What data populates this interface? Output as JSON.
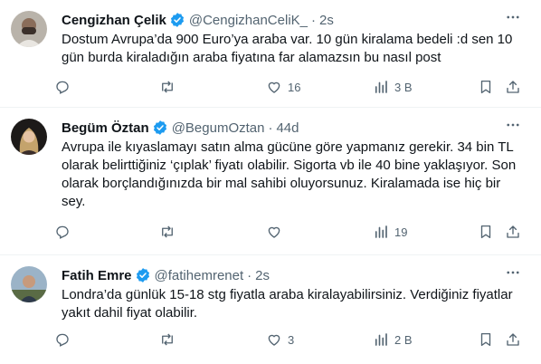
{
  "tweets": [
    {
      "name": "Cengizhan Çelik",
      "handle": "@CengizhanCeliK_",
      "separator": "·",
      "time": "2s",
      "text": "Dostum Avrupa’da 900 Euro’ya araba var. 10 gün kiralama bedeli :d sen 10 gün burda kiraladığın araba fiyatına far alamazsın bu nasıl post",
      "replies": "",
      "retweets": "",
      "likes": "16",
      "views": "3 B"
    },
    {
      "name": "Begüm Öztan",
      "handle": "@BegumOztan",
      "separator": "·",
      "time": "44d",
      "text": "Avrupa ile kıyaslamayı satın alma gücüne göre yapmanız gerekir. 34 bin TL olarak belirttiğiniz ‘çıplak’ fiyatı olabilir. Sigorta vb ile 40 bine yaklaşıyor. Son olarak borçlandığınızda bir mal sahibi oluyorsunuz. Kiralamada ise hiç bir sey.",
      "replies": "",
      "retweets": "",
      "likes": "",
      "views": "19"
    },
    {
      "name": "Fatih Emre",
      "handle": "@fatihemrenet",
      "separator": "·",
      "time": "2s",
      "text": "Londra’da günlük 15-18 stg fiyatla araba kiralayabilirsiniz. Verdiğiniz fiyatlar yakıt dahil fiyat olabilir.",
      "replies": "",
      "retweets": "",
      "likes": "3",
      "views": "2 B"
    }
  ],
  "colors": {
    "text": "#0f1419",
    "muted": "#536471",
    "verified": "#1d9bf0",
    "divider": "#eff3f4"
  },
  "icons": [
    "more-icon",
    "reply-icon",
    "retweet-icon",
    "like-icon",
    "views-icon",
    "bookmark-icon",
    "share-icon",
    "verified-icon"
  ]
}
